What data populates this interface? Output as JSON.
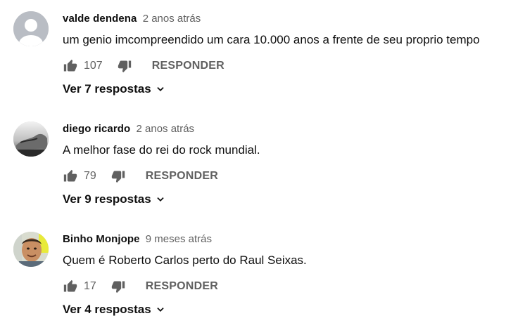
{
  "colors": {
    "text_primary": "#0f0f0f",
    "text_secondary": "#606060",
    "icon": "#606060"
  },
  "comments": [
    {
      "author": "valde dendena",
      "time": "2 anos atrás",
      "text": "um genio imcompreendido um cara 10.000 anos a frente de seu proprio tempo",
      "likes": "107",
      "reply_label": "RESPONDER",
      "replies_label": "Ver 7 respostas",
      "avatar": "default-avatar-icon"
    },
    {
      "author": "diego ricardo",
      "time": "2 anos atrás",
      "text": "A melhor fase do rei do rock mundial.",
      "likes": "79",
      "reply_label": "RESPONDER",
      "replies_label": "Ver 9 respostas",
      "avatar": "photo-avatar"
    },
    {
      "author": "Binho Monjope",
      "time": "9 meses atrás",
      "text": "Quem é Roberto Carlos perto do Raul Seixas.",
      "likes": "17",
      "reply_label": "RESPONDER",
      "replies_label": "Ver 4 respostas",
      "avatar": "photo-avatar"
    }
  ]
}
